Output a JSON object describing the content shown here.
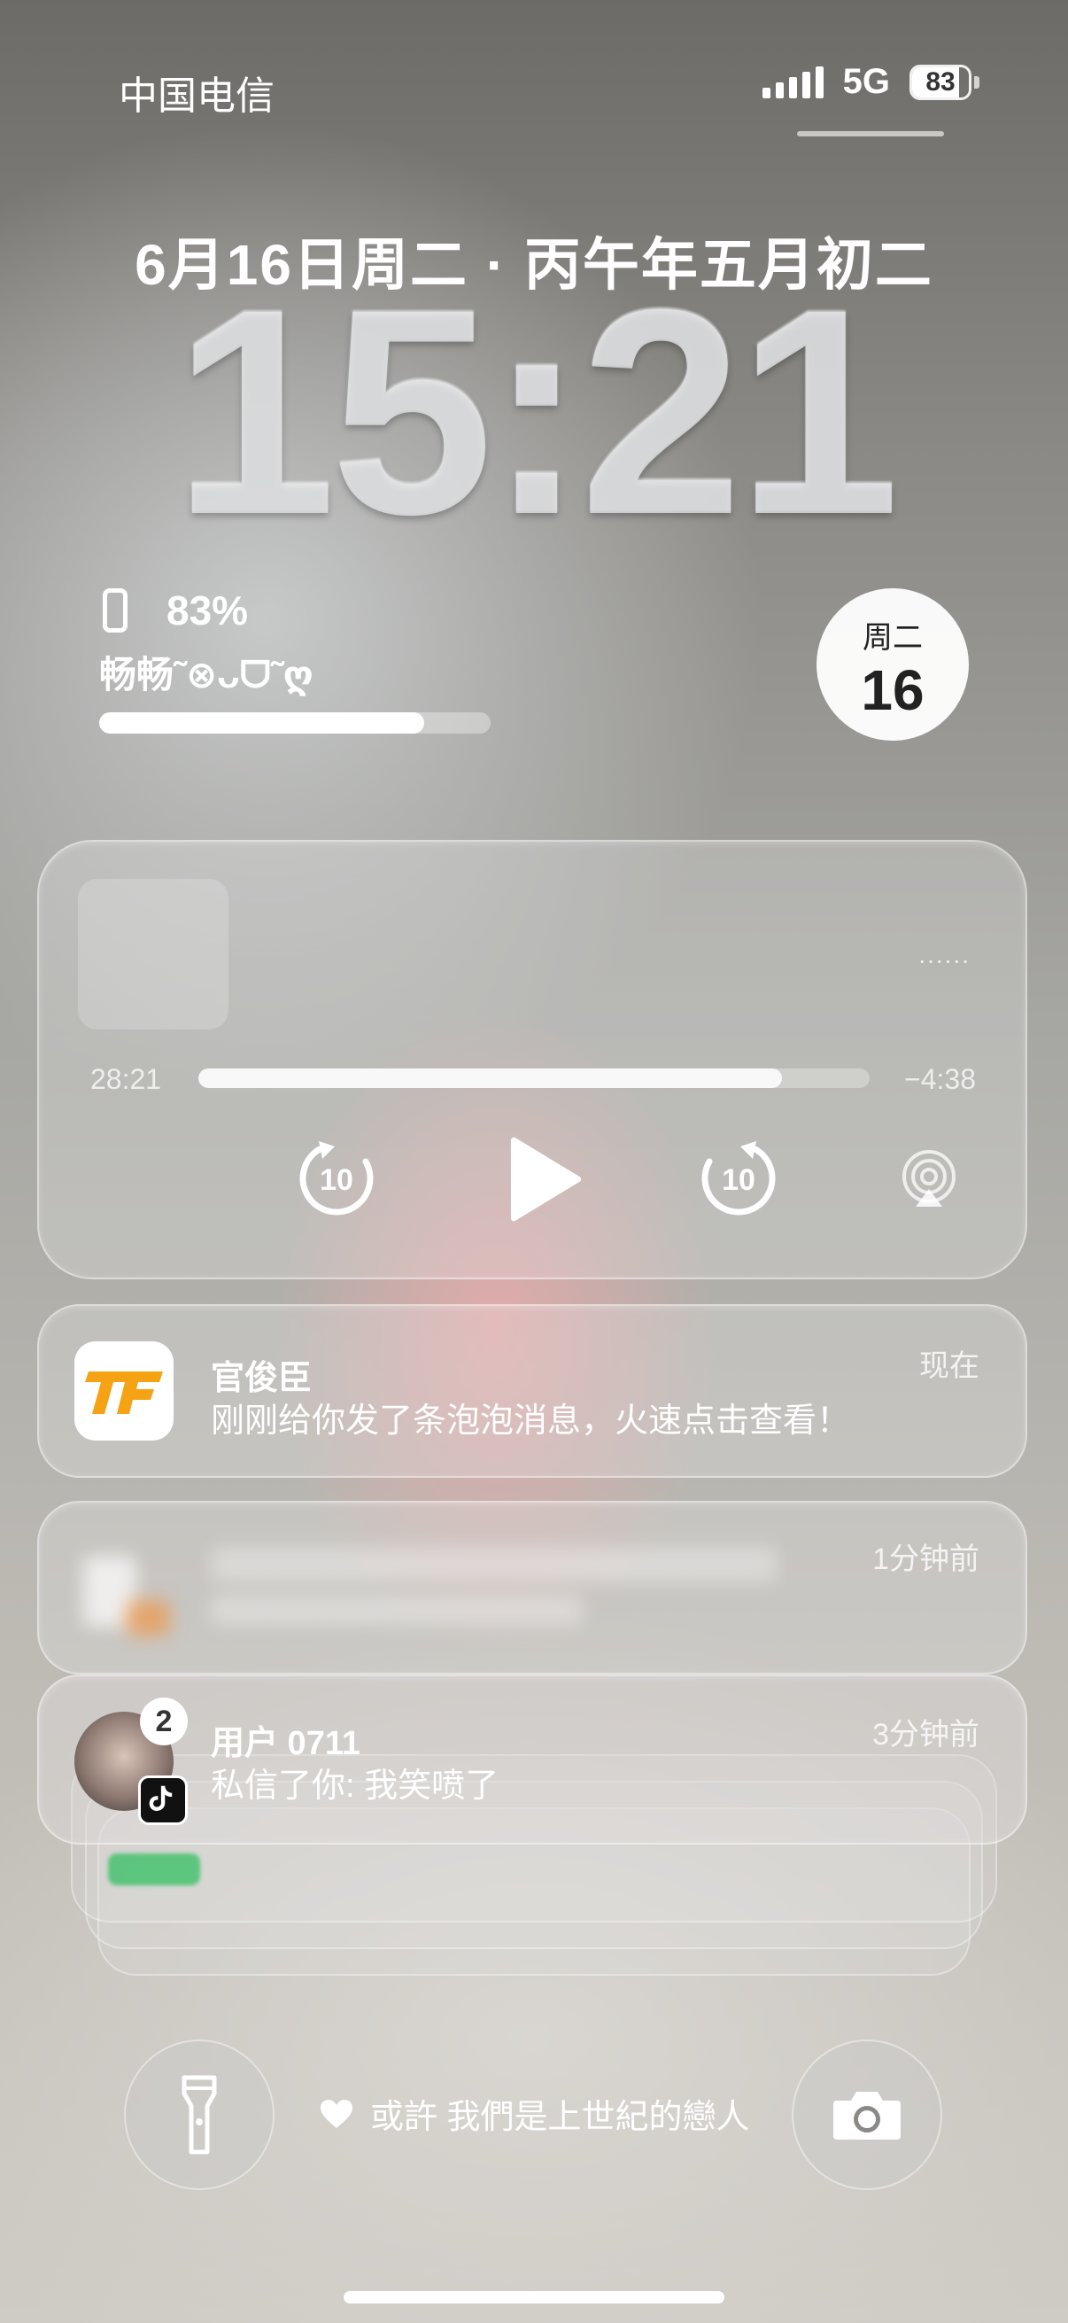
{
  "status_bar": {
    "carrier": "中国电信",
    "network": "5G",
    "battery": "83",
    "battery_level": 0.83
  },
  "lock": {
    "date": "6月16日周二 · 丙午年五月初二",
    "time": "15:21"
  },
  "widgets": {
    "battery_percent": "83%",
    "device_name": "畅畅˜⊗ᴗᗜ˜ღ",
    "battery_level": 0.83,
    "calendar_weekday": "周二",
    "calendar_day": "16"
  },
  "now_playing": {
    "more": "......",
    "elapsed": "28:21",
    "remaining": "−4:38",
    "progress": 0.87,
    "skip_back_seconds": "10",
    "skip_forward_seconds": "10"
  },
  "notifications": [
    {
      "title": "官俊臣",
      "body": "刚刚给你发了条泡泡消息，火速点击查看！",
      "time": "现在",
      "icon": "tf-app-icon"
    },
    {
      "title": "",
      "body": "",
      "time": "1分钟前",
      "icon": "blurred-app-icon"
    },
    {
      "title": "用户 0711",
      "body": "私信了你: 我笑喷了",
      "time": "3分钟前",
      "badge": "2",
      "icon": "avatar-with-tiktok-icon"
    }
  ],
  "bottom": {
    "song": "或許 我們是上世紀的戀人"
  },
  "colors": {
    "tf_orange": "#f5a214",
    "tiktok_black": "#111111"
  }
}
